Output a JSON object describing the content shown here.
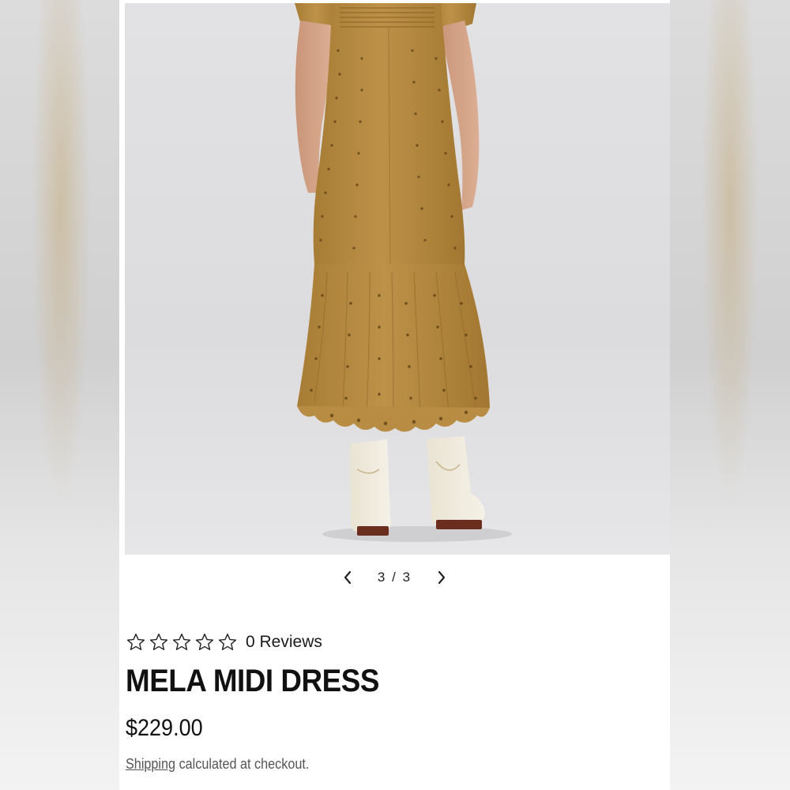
{
  "gallery": {
    "current": "3",
    "separator": "/",
    "total": "3",
    "prev_icon": "chevron-left-icon",
    "next_icon": "chevron-right-icon"
  },
  "product": {
    "rating_stars": 0,
    "rating_max": 5,
    "reviews_label": "0 Reviews",
    "title": "MELA MIDI DRESS",
    "price": "$229.00",
    "shipping_link": "Shipping",
    "shipping_note": "calculated at checkout."
  },
  "colors": {
    "dress": "#b5893f",
    "background": "#e0e0e2",
    "text": "#111111"
  }
}
